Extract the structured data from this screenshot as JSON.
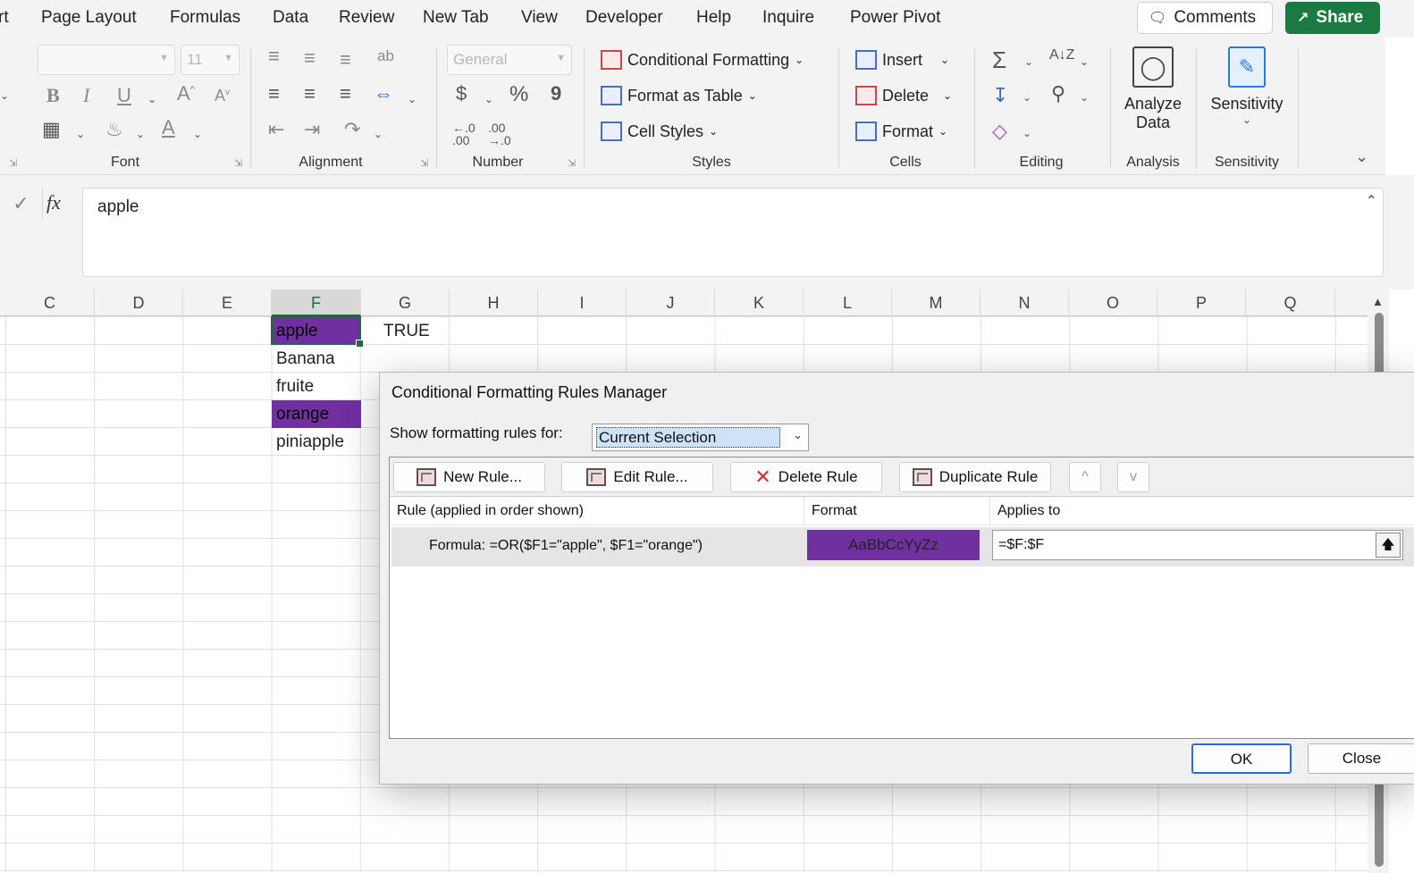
{
  "menubar": {
    "tabs": [
      "rt",
      "Page Layout",
      "Formulas",
      "Data",
      "Review",
      "New Tab",
      "View",
      "Developer",
      "Help",
      "Inquire",
      "Power Pivot"
    ],
    "comments_label": "Comments",
    "share_label": "Share"
  },
  "ribbon": {
    "font": {
      "name_value": "",
      "size_value": "11",
      "bold": "B",
      "italic": "I",
      "underline": "U",
      "group_label": "Font"
    },
    "alignment": {
      "group_label": "Alignment"
    },
    "number": {
      "format_value": "General",
      "currency": "$",
      "percent": "%",
      "comma": "9",
      "group_label": "Number"
    },
    "styles": {
      "conditional_formatting": "Conditional Formatting",
      "format_as_table": "Format as Table",
      "cell_styles": "Cell Styles",
      "group_label": "Styles"
    },
    "cells": {
      "insert": "Insert",
      "delete": "Delete",
      "format": "Format",
      "group_label": "Cells"
    },
    "editing": {
      "group_label": "Editing"
    },
    "analysis": {
      "analyze_line1": "Analyze",
      "analyze_line2": "Data",
      "group_label": "Analysis"
    },
    "sensitivity": {
      "button_label": "Sensitivity",
      "group_label": "Sensitivity"
    }
  },
  "formula_bar": {
    "fx": "fx",
    "value": "apple"
  },
  "sheet": {
    "columns": [
      "C",
      "D",
      "E",
      "F",
      "G",
      "H",
      "I",
      "J",
      "K",
      "L",
      "M",
      "N",
      "O",
      "P",
      "Q"
    ],
    "selected_column": "F",
    "cells": {
      "F1": "apple",
      "G1": "TRUE",
      "F2": "Banana",
      "F3": "fruite",
      "F4": "orange",
      "F5": "piniapple"
    },
    "highlight_color": "#7030a0"
  },
  "dialog": {
    "title": "Conditional Formatting Rules Manager",
    "show_label": "Show formatting rules for:",
    "show_value": "Current Selection",
    "buttons": {
      "new_rule": "New Rule...",
      "edit_rule": "Edit Rule...",
      "delete_rule": "Delete Rule",
      "duplicate_rule": "Duplicate Rule",
      "move_up": "^",
      "move_down": "v"
    },
    "columns": {
      "rule": "Rule (applied in order shown)",
      "format": "Format",
      "applies_to": "Applies to"
    },
    "rules": [
      {
        "rule": "Formula: =OR($F1=\"apple\", $F1=\"orange\")",
        "format_preview": "AaBbCcYyZz",
        "format_color": "#7030a0",
        "applies_to": "=$F:$F"
      }
    ],
    "ok_label": "OK",
    "close_label": "Close"
  }
}
